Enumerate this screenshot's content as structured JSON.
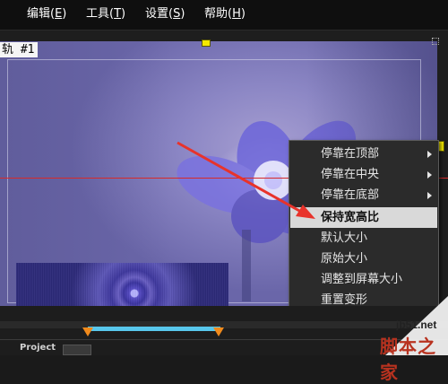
{
  "menubar": {
    "items": [
      {
        "label": "编辑(",
        "key": "E",
        "tail": ")"
      },
      {
        "label": "工具(",
        "key": "T",
        "tail": ")"
      },
      {
        "label": "设置(",
        "key": "S",
        "tail": ")"
      },
      {
        "label": "帮助(",
        "key": "H",
        "tail": ")"
      }
    ]
  },
  "preview": {
    "track_label": "轨 #1"
  },
  "context_menu": {
    "items": [
      {
        "label": "停靠在顶部",
        "submenu": true
      },
      {
        "label": "停靠在中央",
        "submenu": true
      },
      {
        "label": "停靠在底部",
        "submenu": true
      },
      {
        "label": "保持宽高比",
        "submenu": false,
        "highlighted": true
      },
      {
        "label": "默认大小",
        "submenu": false
      },
      {
        "label": "原始大小",
        "submenu": false
      },
      {
        "label": "调整到屏幕大小",
        "submenu": false
      },
      {
        "label": "重置变形",
        "submenu": false
      }
    ]
  },
  "timeline": {
    "project_label": "Project"
  },
  "watermark": {
    "url": "jb51.net",
    "text": "脚本之家"
  },
  "colors": {
    "accent_red": "#d62a2a",
    "range_blue": "#58c7ec",
    "handle_orange": "#f08a1c",
    "handle_yellow": "#f4e800"
  }
}
